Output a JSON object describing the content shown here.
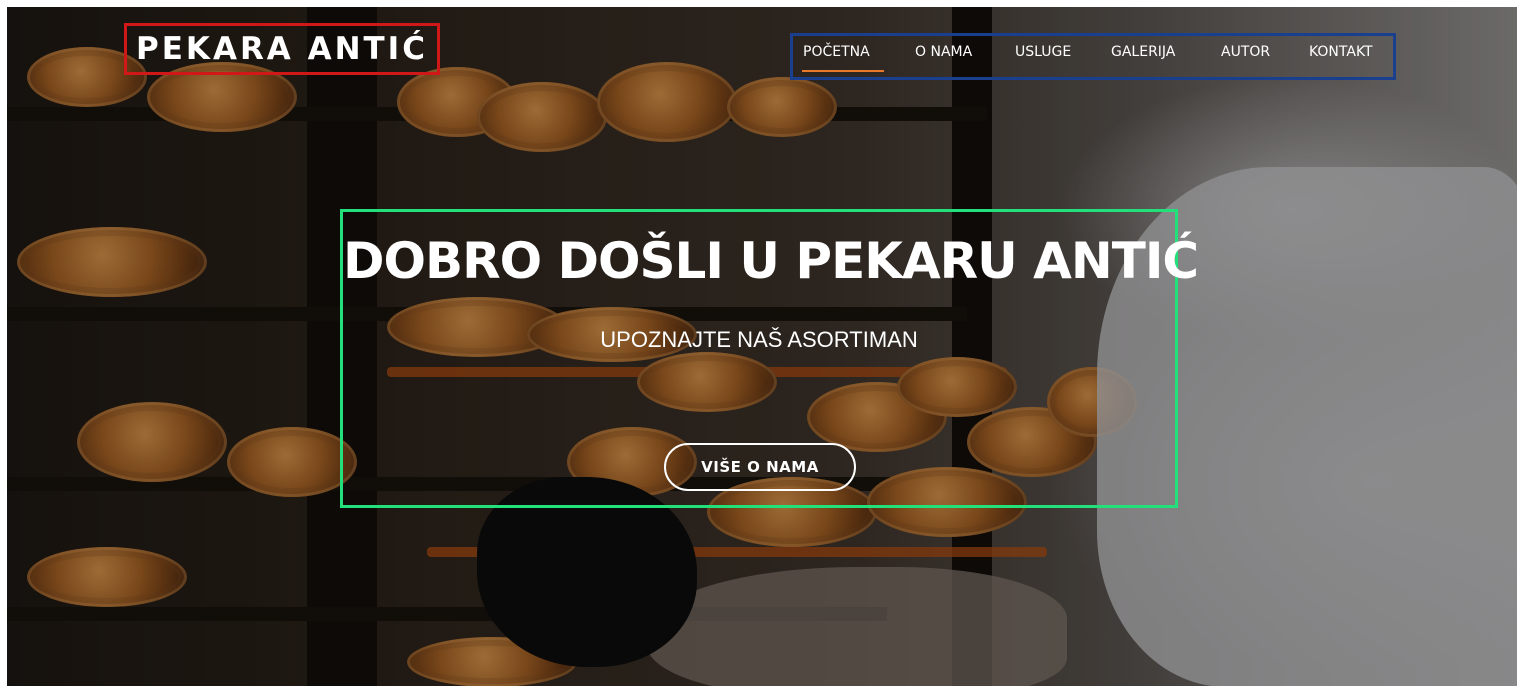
{
  "brand": {
    "logo_text": "PEKARA ANTIĆ"
  },
  "nav": {
    "items": [
      {
        "label": "POČETNA",
        "active": true
      },
      {
        "label": "O NAMA",
        "active": false
      },
      {
        "label": "USLUGE",
        "active": false
      },
      {
        "label": "GALERIJA",
        "active": false
      },
      {
        "label": "AUTOR",
        "active": false
      },
      {
        "label": "KONTAKT",
        "active": false
      }
    ]
  },
  "hero": {
    "title": "DOBRO DOŠLI U PEKARU ANTIĆ",
    "subtitle": "UPOZNAJTE NAŠ ASORTIMAN",
    "button_label": "VIŠE O NAMA"
  },
  "colors": {
    "logo_border": "#d01818",
    "nav_border": "#1b3f8f",
    "hero_border": "#22e07a",
    "active_underline": "#e8782a",
    "text": "#ffffff"
  }
}
